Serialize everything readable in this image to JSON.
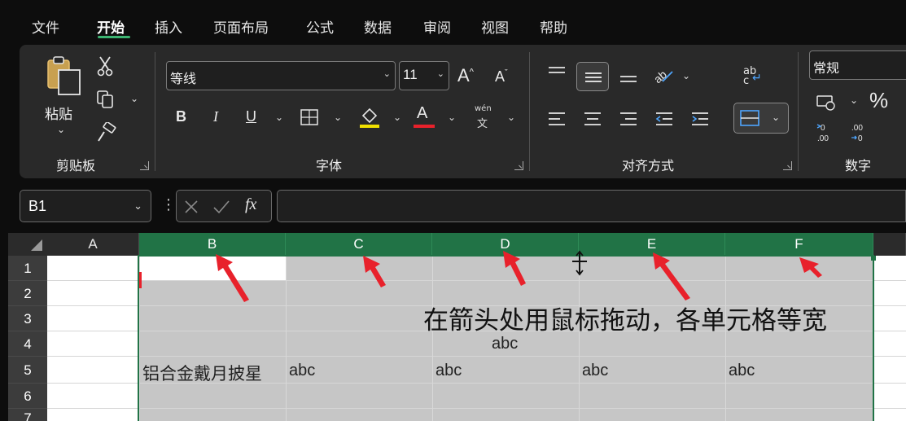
{
  "menu": {
    "tabs": [
      "文件",
      "开始",
      "插入",
      "页面布局",
      "公式",
      "数据",
      "审阅",
      "视图",
      "帮助"
    ],
    "active": "开始"
  },
  "ribbon": {
    "clipboard": {
      "label": "剪贴板",
      "paste_label": "粘贴"
    },
    "font": {
      "label": "字体",
      "font_name": "等线",
      "font_size": "11",
      "bold": "B",
      "italic": "I",
      "underline": "U",
      "font_color": "A",
      "phonetic_top": "wén",
      "phonetic_bottom": "文"
    },
    "alignment": {
      "label": "对齐方式",
      "wrap_top": "ab",
      "wrap_bottom": "c"
    },
    "number": {
      "label": "数字",
      "format": "常规",
      "percent": "%"
    }
  },
  "formula_bar": {
    "name_box": "B1",
    "fx": "fx",
    "content": ""
  },
  "grid": {
    "columns": [
      "A",
      "B",
      "C",
      "D",
      "E",
      "F"
    ],
    "selected_columns": [
      "B",
      "C",
      "D",
      "E",
      "F"
    ],
    "rows": [
      "1",
      "2",
      "3",
      "4",
      "5",
      "6",
      "7"
    ],
    "cells": {
      "D4": "abc",
      "B5": "铝合金戴月披星",
      "C5": "abc",
      "D5": "abc",
      "E5": "abc",
      "F5": "abc"
    }
  },
  "annotation": "在箭头处用鼠标拖动，各单元格等宽",
  "colors": {
    "accent_green": "#217346",
    "arrow_red": "#e8212b",
    "selection_gray": "#c6c6c6"
  }
}
